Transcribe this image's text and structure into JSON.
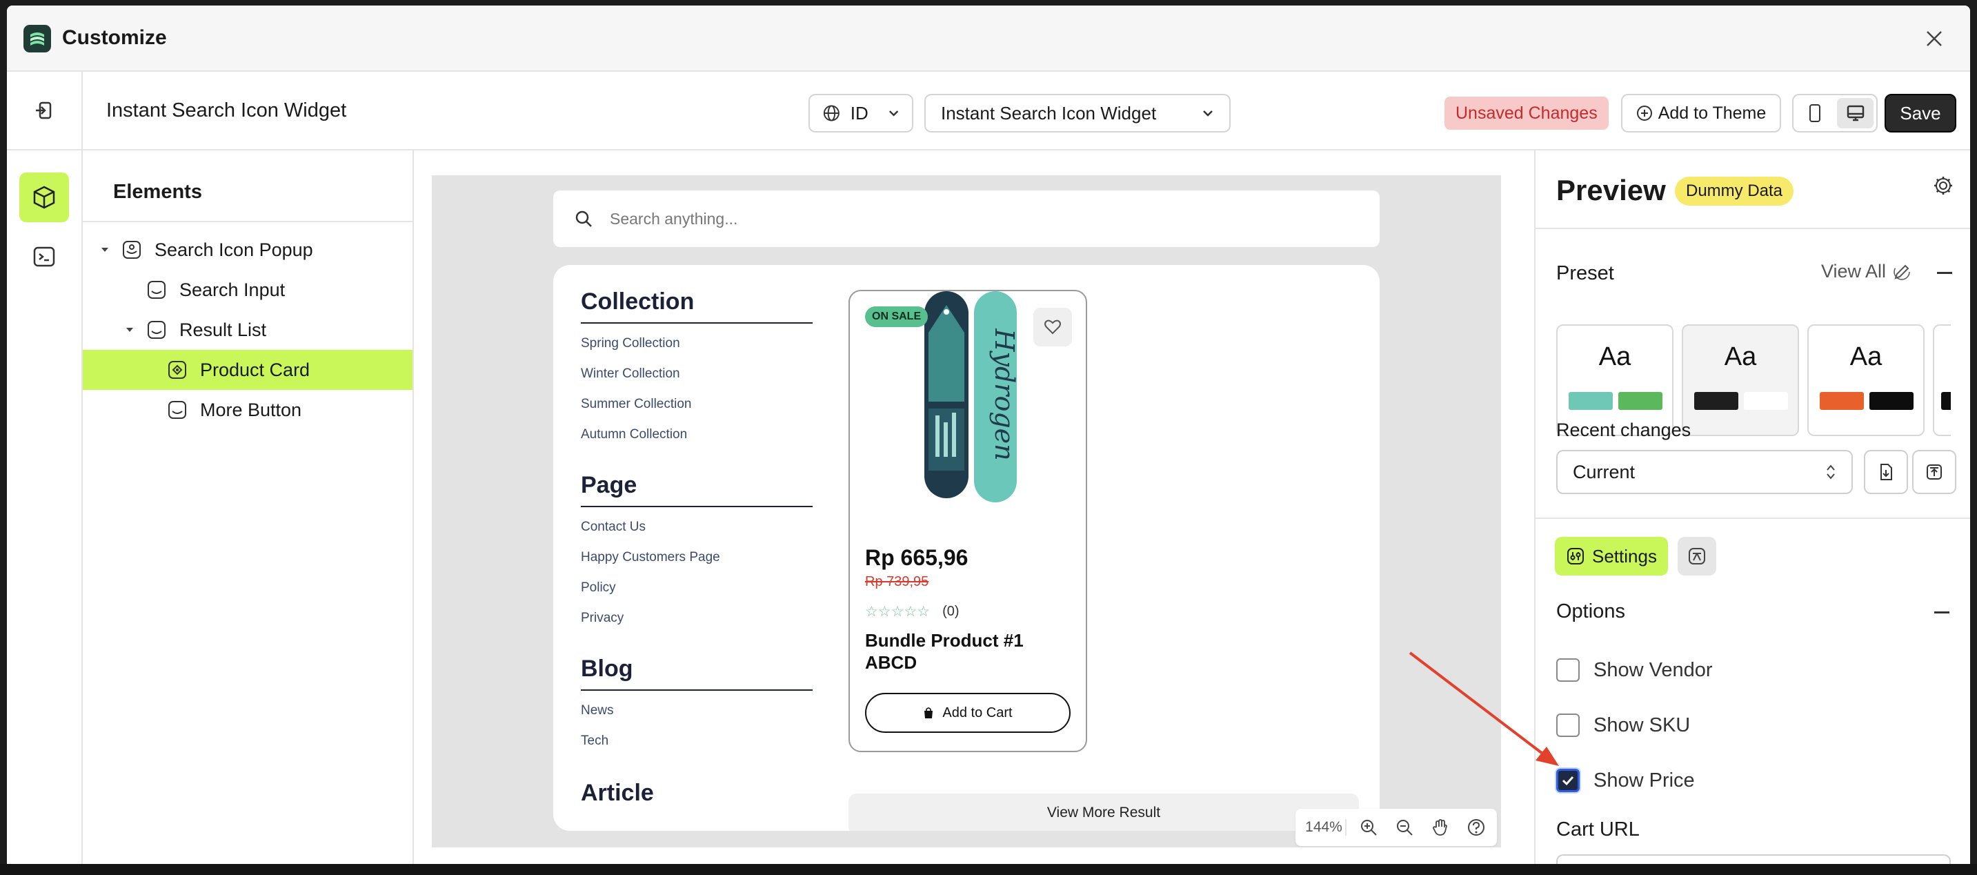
{
  "app": {
    "title": "Customize"
  },
  "toolbar": {
    "widget_title": "Instant Search Icon Widget",
    "language": "ID",
    "widget_select": "Instant Search Icon Widget",
    "unsaved_label": "Unsaved Changes",
    "add_theme_label": "Add to Theme",
    "save_label": "Save"
  },
  "elements": {
    "heading": "Elements",
    "items": [
      {
        "label": "Search Icon Popup"
      },
      {
        "label": "Search Input"
      },
      {
        "label": "Result List"
      },
      {
        "label": "Product Card"
      },
      {
        "label": "More Button"
      }
    ]
  },
  "preview": {
    "search_placeholder": "Search anything...",
    "sections": [
      {
        "title": "Collection",
        "links": [
          "Spring Collection",
          "Winter Collection",
          "Summer Collection",
          "Autumn Collection"
        ]
      },
      {
        "title": "Page",
        "links": [
          "Contact Us",
          "Happy Customers Page",
          "Policy",
          "Privacy"
        ]
      },
      {
        "title": "Blog",
        "links": [
          "News",
          "Tech"
        ]
      },
      {
        "title": "Article",
        "links": []
      }
    ],
    "product": {
      "badge": "ON SALE",
      "price": "Rp 665,96",
      "old_price": "Rp 739,95",
      "stars": "☆☆☆☆☆",
      "review_count": "(0)",
      "name": "Bundle Product #1 ABCD",
      "add_to_cart": "Add to Cart",
      "image_text": "Hydrogen"
    },
    "view_more": "View More Result",
    "zoom": "144%"
  },
  "panel": {
    "title": "Preview",
    "dummy_badge": "Dummy Data",
    "preset_heading": "Preset",
    "view_all": "View All",
    "presets": [
      {
        "label": "Aa",
        "colors": [
          "#6fc7b5",
          "#5cb85c"
        ]
      },
      {
        "label": "Aa",
        "colors": [
          "#1e1e1e",
          "#ffffff"
        ]
      },
      {
        "label": "Aa",
        "colors": [
          "#e8612c",
          "#0d0d0d"
        ]
      }
    ],
    "recent_label": "Recent changes",
    "recent_value": "Current",
    "settings_tab": "Settings",
    "options_heading": "Options",
    "options": [
      {
        "label": "Show Vendor",
        "checked": false
      },
      {
        "label": "Show SKU",
        "checked": false
      },
      {
        "label": "Show Price",
        "checked": true
      }
    ],
    "cart_url_label": "Cart URL"
  },
  "colors": {
    "accent": "#c9f75a",
    "dark": "#2a2a2a",
    "annotation_arrow": "#e2412b"
  }
}
